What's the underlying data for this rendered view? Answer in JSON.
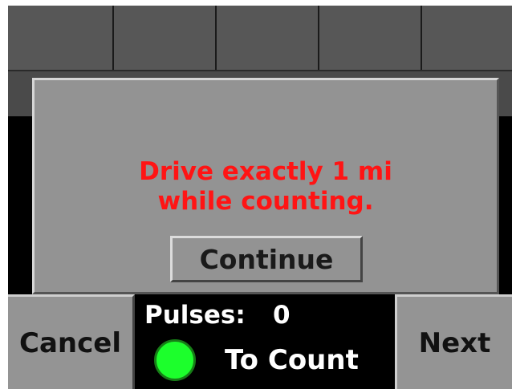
{
  "dialog": {
    "message_line1": "Drive exactly 1 mi",
    "message_line2": "while counting.",
    "continue_label": "Continue"
  },
  "bottom_bar": {
    "cancel_label": "Cancel",
    "next_label": "Next",
    "pulses_label": "Pulses:",
    "pulses_value": "0",
    "status_label": "To Count",
    "status_led_color": "#1cff2c"
  },
  "colors": {
    "message": "#ff1414",
    "panel_gray": "#939393"
  }
}
